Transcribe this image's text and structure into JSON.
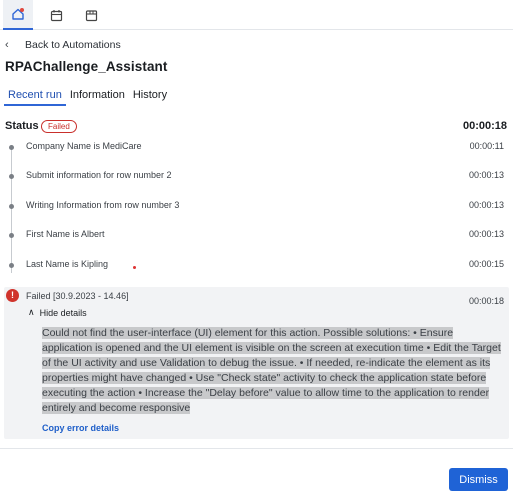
{
  "nav": {
    "items": [
      {
        "name": "home",
        "icon": "home-icon"
      },
      {
        "name": "calendar",
        "icon": "calendar-icon"
      },
      {
        "name": "store",
        "icon": "store-icon"
      }
    ],
    "accent": "#2f66d6"
  },
  "header": {
    "back_label": "Back to Automations",
    "title": "RPAChallenge_Assistant"
  },
  "tabs": [
    {
      "label": "Recent run",
      "active": true
    },
    {
      "label": "Information",
      "active": false
    },
    {
      "label": "History",
      "active": false
    }
  ],
  "status": {
    "label": "Status",
    "badge": "Failed",
    "badge_color": "#c9302c",
    "duration": "00:00:18"
  },
  "steps": [
    {
      "text": "Company Name is MediCare",
      "time": "00:00:11"
    },
    {
      "text": "Submit information for row number 2",
      "time": "00:00:13"
    },
    {
      "text": "Writing Information from row number 3",
      "time": "00:00:13"
    },
    {
      "text": "First Name is Albert",
      "time": "00:00:13"
    },
    {
      "text": "Last Name is Kipling",
      "time": "00:00:15"
    }
  ],
  "error": {
    "title": "Failed [30.9.2023 - 14.46]",
    "time": "00:00:18",
    "hide_label": "Hide details",
    "message": "Could not find the user-interface (UI) element for this action. Possible solutions: • Ensure application is opened and the UI element is visible on the screen at execution time • Edit the Target of the UI activity and use Validation to debug the issue. • If needed, re-indicate the element as its properties might have changed • Use \"Check state\" activity to check the application state before executing the action • Increase the \"Delay before\" value to allow time to the application to render entirely and become responsive",
    "copy_label": "Copy error details",
    "icon_color": "#d0342c"
  },
  "footer": {
    "dismiss_label": "Dismiss",
    "button_color": "#1f63d6"
  }
}
